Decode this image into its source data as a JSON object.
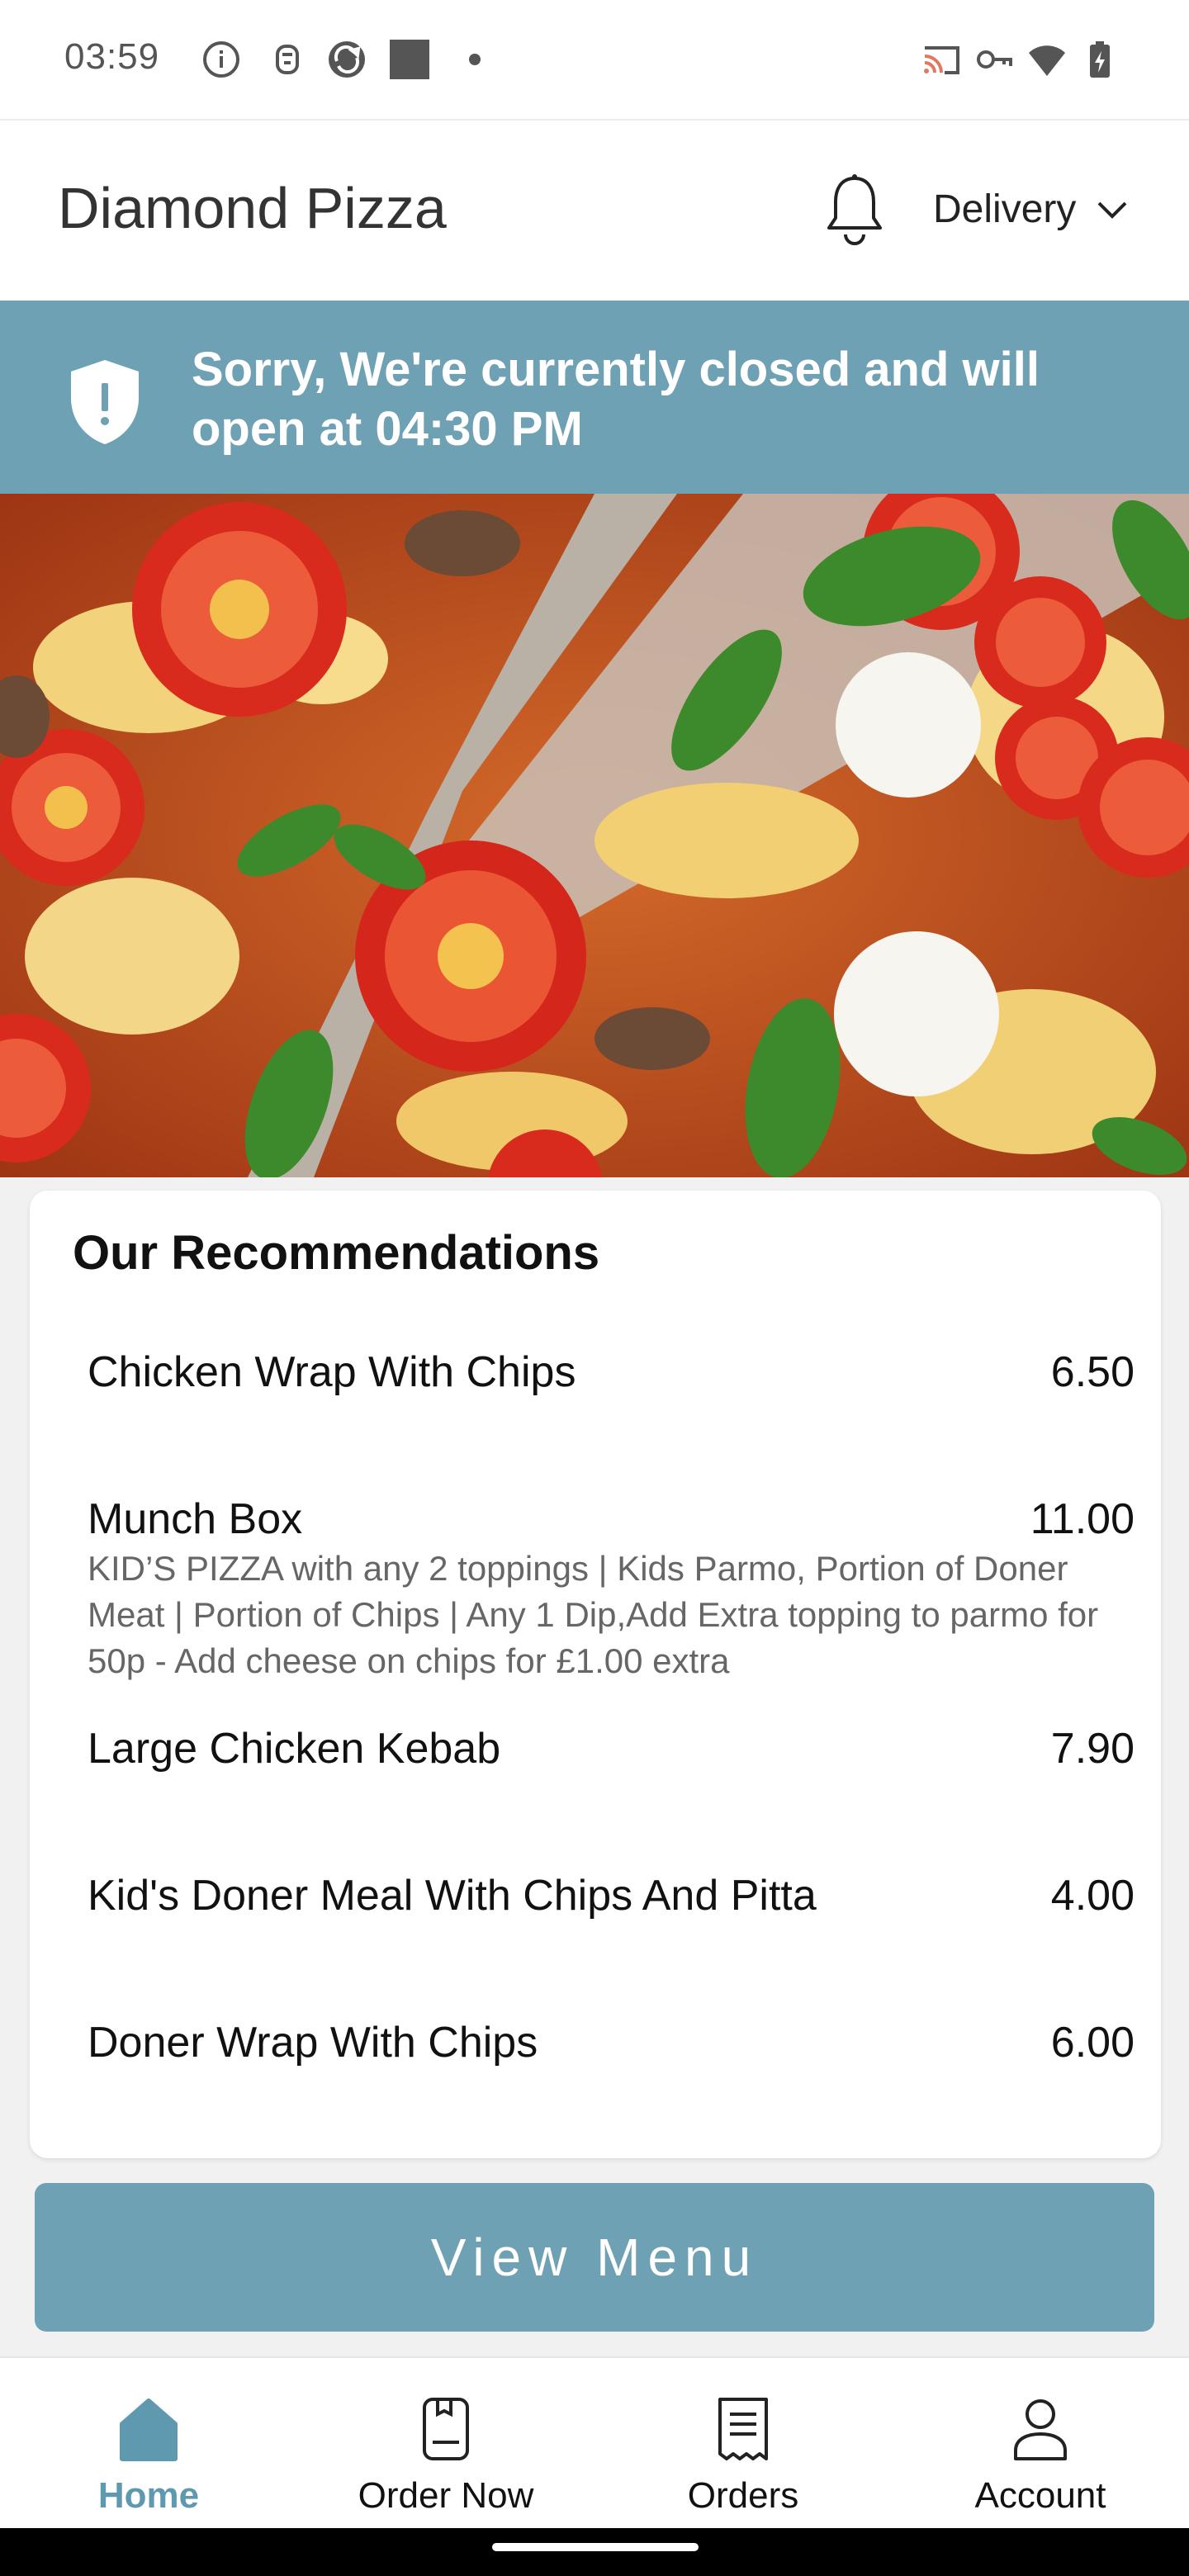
{
  "status_bar": {
    "time": "03:59",
    "left_icons": [
      "info-icon",
      "notification-app-icon",
      "sync-app-icon",
      "square-app-icon",
      "dot-icon"
    ],
    "right_icons": [
      "cast-icon",
      "vpn-key-icon",
      "wifi-icon",
      "battery-icon"
    ]
  },
  "header": {
    "title": "Diamond Pizza",
    "notification_icon": "bell-icon",
    "order_type": "Delivery"
  },
  "banner": {
    "message": "Sorry, We're currently closed and will open at 04:30 PM",
    "icon": "shield-alert-icon",
    "color": "#6ea1b3"
  },
  "hero": {
    "image": "pizza-photo"
  },
  "recommendations": {
    "title": "Our Recommendations",
    "items": [
      {
        "name": "Chicken Wrap With Chips",
        "price": "6.50",
        "description": ""
      },
      {
        "name": "Munch Box",
        "price": "11.00",
        "description": "KID’S PIZZA with any 2 toppings | Kids Parmo, Portion of Doner Meat | Portion of Chips | Any 1 Dip,Add Extra topping to parmo for 50p - Add cheese on chips for £1.00 extra"
      },
      {
        "name": "Large Chicken Kebab",
        "price": "7.90",
        "description": ""
      },
      {
        "name": "Kid's Doner Meal With Chips And Pitta",
        "price": "4.00",
        "description": ""
      },
      {
        "name": "Doner Wrap With Chips",
        "price": "6.00",
        "description": ""
      }
    ]
  },
  "view_menu": {
    "label": "View Menu",
    "color": "#6ea1b3"
  },
  "bottom_nav": {
    "items": [
      {
        "label": "Home",
        "icon": "home-icon",
        "active": true
      },
      {
        "label": "Order Now",
        "icon": "order-book-icon",
        "active": false
      },
      {
        "label": "Orders",
        "icon": "receipt-icon",
        "active": false
      },
      {
        "label": "Account",
        "icon": "person-icon",
        "active": false
      }
    ],
    "active_color": "#5f99b0"
  }
}
